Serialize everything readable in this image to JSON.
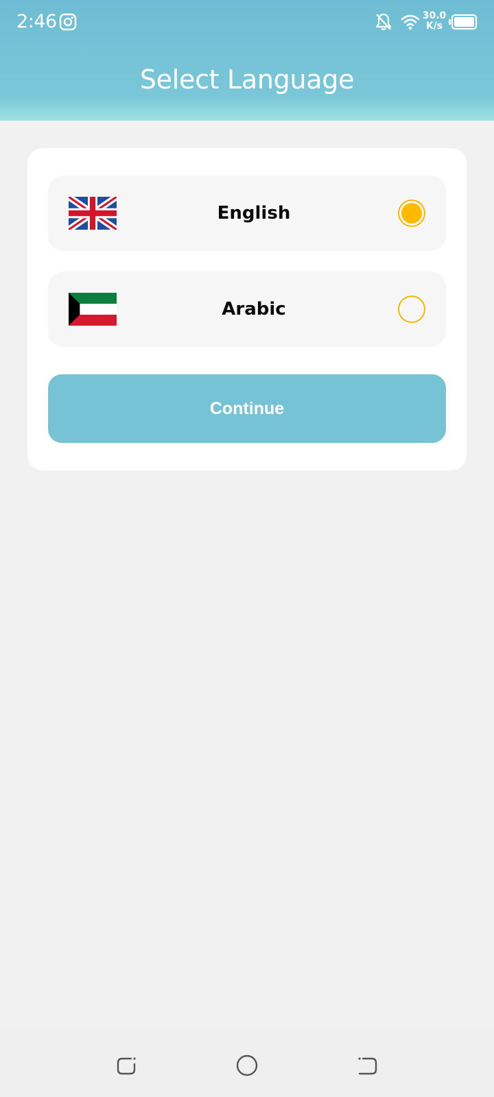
{
  "status_bar": {
    "time": "2:46",
    "net_speed_value": "30.0",
    "net_speed_unit": "K/s",
    "icons": [
      "instagram-icon",
      "bell-off-icon",
      "wifi-icon",
      "battery-icon"
    ]
  },
  "header": {
    "title": "Select Language"
  },
  "languages": [
    {
      "label": "English",
      "flag": "uk-flag-icon",
      "selected": true
    },
    {
      "label": "Arabic",
      "flag": "kuwait-flag-icon",
      "selected": false
    }
  ],
  "continue_label": "Continue",
  "nav_bar": {
    "icons": [
      "recents-icon",
      "home-icon",
      "back-icon"
    ]
  },
  "colors": {
    "header": "#76c3d6",
    "accent": "#ffba00",
    "button": "#76c3d6",
    "background": "#f1f1f1"
  }
}
